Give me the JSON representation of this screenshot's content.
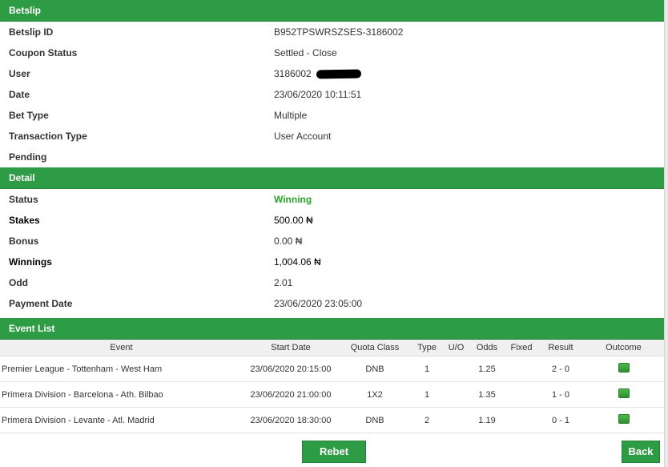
{
  "betslip": {
    "header": "Betslip",
    "rows": [
      {
        "label": "Betslip ID",
        "value": "B952TPSWRSZSES-3186002"
      },
      {
        "label": "Coupon Status",
        "value": "Settled - Close"
      },
      {
        "label": "User",
        "value": "3186002"
      },
      {
        "label": "Date",
        "value": "23/06/2020 10:11:51"
      },
      {
        "label": "Bet Type",
        "value": "Multiple"
      },
      {
        "label": "Transaction Type",
        "value": "User Account"
      },
      {
        "label": "Pending",
        "value": ""
      }
    ]
  },
  "detail": {
    "header": "Detail",
    "rows": [
      {
        "label": "Status",
        "value": "Winning"
      },
      {
        "label": "Stakes",
        "value": "500.00 ₦"
      },
      {
        "label": "Bonus",
        "value": "0.00 ₦"
      },
      {
        "label": "Winnings",
        "value": "1,004.06 ₦"
      },
      {
        "label": "Odd",
        "value": "2.01"
      },
      {
        "label": "Payment Date",
        "value": "23/06/2020 23:05:00"
      }
    ]
  },
  "event_list": {
    "header": "Event List",
    "columns": [
      "Event",
      "Start Date",
      "Quota Class",
      "Type",
      "U/O",
      "Odds",
      "Fixed",
      "Result",
      "Outcome"
    ],
    "rows": [
      {
        "event": "Premier League - Tottenham - West Ham",
        "start_date": "23/06/2020 20:15:00",
        "quota_class": "DNB",
        "type": "1",
        "uo": "",
        "odds": "1.25",
        "fixed": "",
        "result": "2 - 0",
        "outcome": "won-icon"
      },
      {
        "event": "Primera Division - Barcelona - Ath. Bilbao",
        "start_date": "23/06/2020 21:00:00",
        "quota_class": "1X2",
        "type": "1",
        "uo": "",
        "odds": "1.35",
        "fixed": "",
        "result": "1 - 0",
        "outcome": "won-icon"
      },
      {
        "event": "Primera Division - Levante - Atl. Madrid",
        "start_date": "23/06/2020 18:30:00",
        "quota_class": "DNB",
        "type": "2",
        "uo": "",
        "odds": "1.19",
        "fixed": "",
        "result": "0 - 1",
        "outcome": "won-icon"
      }
    ]
  },
  "buttons": {
    "rebet": "Rebet",
    "back": "Back"
  },
  "colors": {
    "accent": "#2e9b45",
    "status_green": "#2aa52a"
  }
}
